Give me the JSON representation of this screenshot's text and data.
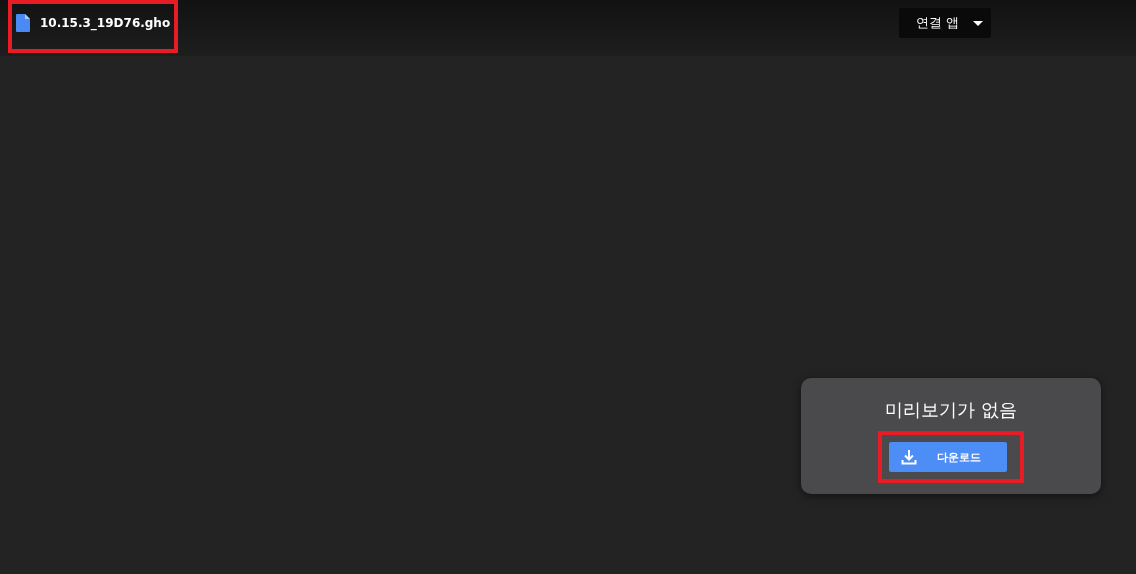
{
  "header": {
    "file_name": "10.15.3_19D76.gho",
    "file_highlighted": true,
    "open_with": {
      "label": "연결 앱"
    }
  },
  "preview": {
    "message": "미리보기가 없음",
    "download": {
      "label": "다운로드",
      "highlighted": true
    }
  }
}
